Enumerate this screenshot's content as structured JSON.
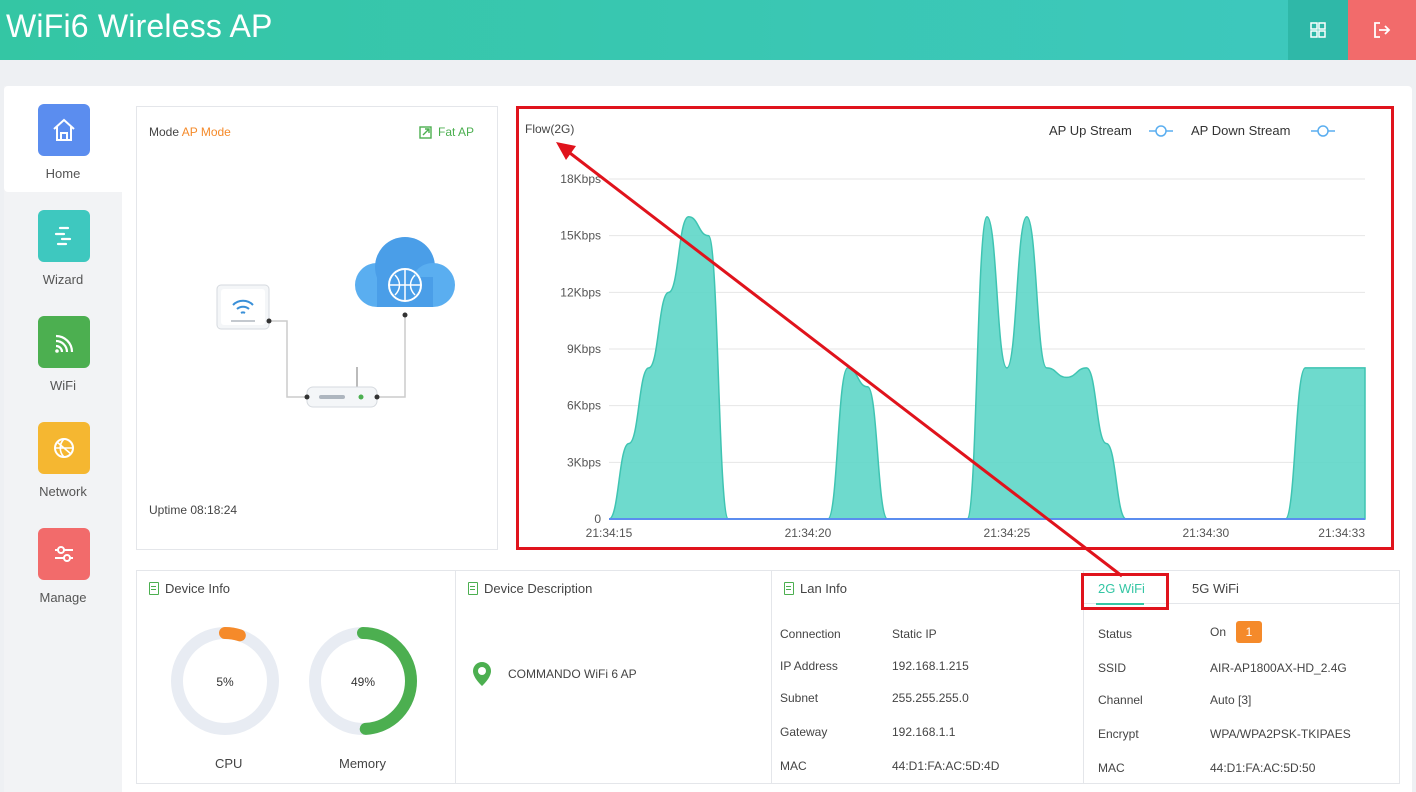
{
  "header": {
    "title": "WiFi6 Wireless AP"
  },
  "sidebar": {
    "items": [
      {
        "label": "Home",
        "color": "#5b8def"
      },
      {
        "label": "Wizard",
        "color": "#3ec8bf"
      },
      {
        "label": "WiFi",
        "color": "#4caf50"
      },
      {
        "label": "Network",
        "color": "#f5b731"
      },
      {
        "label": "Manage",
        "color": "#f26b6b"
      }
    ]
  },
  "mode": {
    "label": "Mode",
    "value": "AP Mode",
    "fat_ap": "Fat AP",
    "uptime_label": "Uptime",
    "uptime_value": "08:18:24"
  },
  "chart_data": {
    "type": "area",
    "title": "Flow(2G)",
    "legend": [
      "AP Up Stream",
      "AP Down Stream"
    ],
    "y_ticks": [
      "0",
      "3Kbps",
      "6Kbps",
      "9Kbps",
      "12Kbps",
      "15Kbps",
      "18Kbps"
    ],
    "ylim": [
      0,
      18
    ],
    "y_unit": "Kbps",
    "x_ticks": [
      "21:34:15",
      "21:34:20",
      "21:34:25",
      "21:34:30",
      "21:34:33"
    ],
    "series": [
      {
        "name": "AP Up Stream",
        "x": [
          0,
          0.5,
          1,
          1.5,
          2,
          2.5,
          3,
          3.5,
          4,
          4.5,
          5,
          5.5,
          6,
          6.5,
          7,
          7.5,
          8,
          8.5,
          9,
          9.5,
          10,
          10.5,
          11,
          11.5,
          12,
          12.5,
          13,
          13.5,
          14,
          14.5,
          15,
          15.5,
          16,
          16.5,
          17,
          17.5,
          18,
          18.5,
          19
        ],
        "values": [
          0,
          4,
          8,
          12,
          16,
          15,
          0,
          0,
          0,
          0,
          0,
          0,
          8,
          7,
          0,
          0,
          0,
          0,
          0,
          16,
          8,
          16,
          8,
          7.5,
          8,
          4,
          0,
          0,
          0,
          0,
          0,
          0,
          0,
          0,
          0,
          8,
          8,
          8,
          8
        ]
      }
    ]
  },
  "device_info": {
    "title": "Device Info",
    "cpu": {
      "label": "CPU",
      "value": "5%",
      "percent": 5
    },
    "memory": {
      "label": "Memory",
      "value": "49%",
      "percent": 49
    }
  },
  "device_description": {
    "title": "Device Description",
    "name": "COMMANDO WiFi 6 AP"
  },
  "lan_info": {
    "title": "Lan Info",
    "rows": [
      {
        "key": "Connection",
        "value": "Static IP"
      },
      {
        "key": "IP Address",
        "value": "192.168.1.215"
      },
      {
        "key": "Subnet",
        "value": "255.255.255.0"
      },
      {
        "key": "Gateway",
        "value": "192.168.1.1"
      },
      {
        "key": "MAC",
        "value": "44:D1:FA:AC:5D:4D"
      }
    ]
  },
  "wifi": {
    "tabs": [
      "2G WiFi",
      "5G WiFi"
    ],
    "status_label": "Status",
    "status_value": "On",
    "status_badge": "1",
    "rows": [
      {
        "key": "SSID",
        "value": "AIR-AP1800AX-HD_2.4G"
      },
      {
        "key": "Channel",
        "value": "Auto [3]"
      },
      {
        "key": "Encrypt",
        "value": "WPA/WPA2PSK-TKIPAES"
      },
      {
        "key": "MAC",
        "value": "44:D1:FA:AC:5D:50"
      }
    ]
  },
  "colors": {
    "accent": "#34c6a4",
    "orange": "#f58a2a",
    "highlight": "#e0131c"
  }
}
